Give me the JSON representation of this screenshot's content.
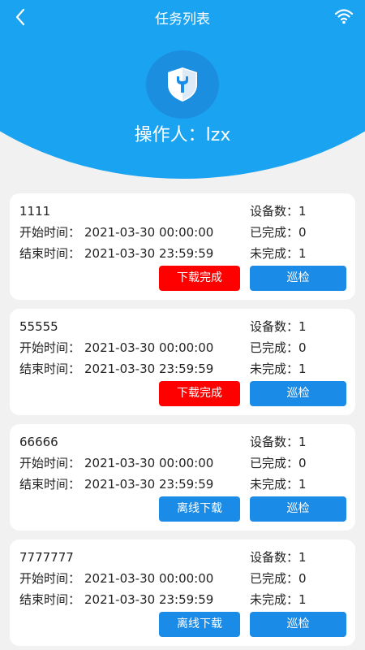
{
  "topbar": {
    "title": "任务列表",
    "back_icon": "chevron-left-icon",
    "wifi_icon": "wifi-icon"
  },
  "header": {
    "operator": "操作人：lzx",
    "logo_icon": "shield-wrench-icon"
  },
  "colors": {
    "primary": "#1aa3f0",
    "button_blue": "#1a8be6",
    "button_red": "#ff0000"
  },
  "labels": {
    "start": "开始时间：",
    "end": "结束时间：",
    "devices": "设备数：",
    "done": "已完成：",
    "undone": "未完成：",
    "inspect": "巡检"
  },
  "tasks": [
    {
      "name": "1111",
      "start": "2021-03-30 00:00:00",
      "end": "2021-03-30 23:59:59",
      "devices": "1",
      "done": "0",
      "undone": "1",
      "action": "下载完成",
      "action_color": "red"
    },
    {
      "name": "55555",
      "start": "2021-03-30 00:00:00",
      "end": "2021-03-30 23:59:59",
      "devices": "1",
      "done": "0",
      "undone": "1",
      "action": "下载完成",
      "action_color": "red"
    },
    {
      "name": "66666",
      "start": "2021-03-30 00:00:00",
      "end": "2021-03-30 23:59:59",
      "devices": "1",
      "done": "0",
      "undone": "1",
      "action": "离线下载",
      "action_color": "blue"
    },
    {
      "name": "7777777",
      "start": "2021-03-30 00:00:00",
      "end": "2021-03-30 23:59:59",
      "devices": "1",
      "done": "0",
      "undone": "1",
      "action": "离线下载",
      "action_color": "blue"
    }
  ]
}
